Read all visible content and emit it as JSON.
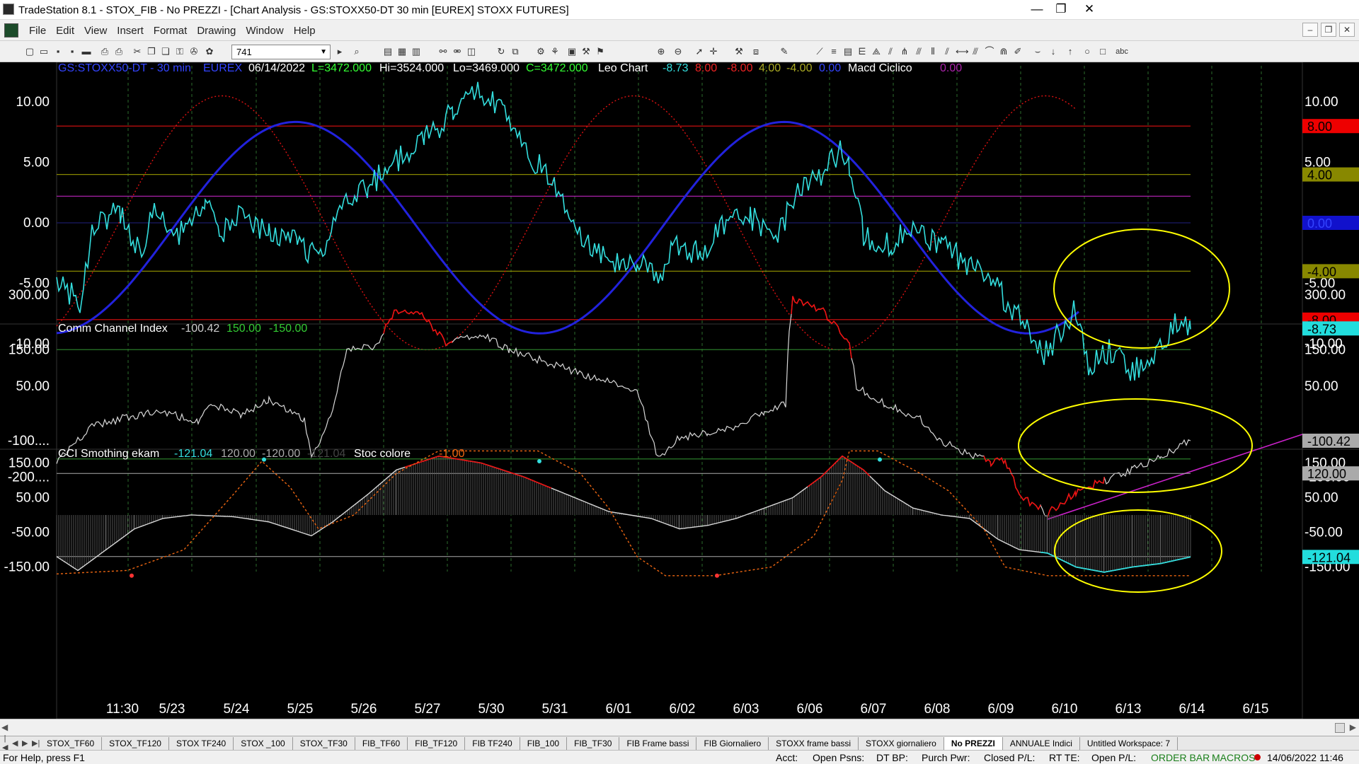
{
  "window": {
    "title": "TradeStation 8.1 - STOX_FIB - No PREZZI - [Chart Analysis - GS:STOXX50-DT  30 min  [EUREX] STOXX FUTURES]",
    "minimize_label": "—",
    "maximize_label": "❐",
    "close_label": "✕"
  },
  "menu": {
    "items": [
      "File",
      "Edit",
      "View",
      "Insert",
      "Format",
      "Drawing",
      "Window",
      "Help"
    ],
    "mdi_minimize": "–",
    "mdi_restore": "❐",
    "mdi_close": "✕"
  },
  "toolbar": {
    "combo_value": "741"
  },
  "chart": {
    "price_header": {
      "symbol": "GS:STOXX50-DT - 30 min",
      "exchange": "EUREX",
      "date": "06/14/2022",
      "last": "L=3472.000",
      "high": "Hi=3524.000",
      "low": "Lo=3469.000",
      "close": "C=3472.000",
      "study": "Leo Chart",
      "v1": "-8.73",
      "v2": "8.00",
      "v3": "-8.00",
      "v4": "4.00",
      "v5": "-4.00",
      "v6": "0.00",
      "study2": "Macd Ciclico",
      "v7": "0.00"
    },
    "cci_header": {
      "name": "Comm Channel Index",
      "v1": "-100.42",
      "v2": "150.00",
      "v3": "-150.00"
    },
    "ccis_header": {
      "name": "CCI Smothing ekam",
      "v1": "-121.04",
      "v2": "120.00",
      "v3": "-120.00",
      "v4": "-121.04",
      "name2": "Stoc colore",
      "v5": "-1.00"
    },
    "colors": {
      "background": "#000000",
      "cyan": "#33dddd",
      "blue": "#2222dd",
      "red": "#dd1111",
      "olive": "#888800",
      "purple": "#aa22aa",
      "white_line": "#c8c8c8",
      "yellow": "#ffff00",
      "magenta": "#cc22cc",
      "green_level": "#2a7a2a"
    },
    "x_labels": [
      "11:30",
      "5/23",
      "5/24",
      "5/25",
      "5/26",
      "5/27",
      "5/30",
      "5/31",
      "6/01",
      "6/02",
      "6/03",
      "6/06",
      "6/07",
      "6/08",
      "6/09",
      "6/10",
      "6/13",
      "6/14",
      "6/15"
    ],
    "panel1": {
      "left_ticks": [
        "10.00",
        "5.00",
        "0.00",
        "-5.00",
        "-10.00"
      ],
      "right_ticks": [
        "10.00",
        "5.00",
        "-5.00",
        "-10.00"
      ],
      "badges": [
        "8.00",
        "4.00",
        "0.00",
        "-4.00",
        "-8.00",
        "-8.73"
      ]
    },
    "panel2": {
      "left_ticks": [
        "300.00",
        "150.00",
        "50.00",
        "-100....",
        "-200...."
      ],
      "right_ticks": [
        "300.00",
        "150.00",
        "50.00",
        "-200.00"
      ],
      "badges": [
        "-100.42"
      ]
    },
    "panel3": {
      "left_ticks": [
        "150.00",
        "50.00",
        "-50.00",
        "-150.00"
      ],
      "right_ticks": [
        "150.00",
        "50.00",
        "-50.00",
        "-150.00"
      ],
      "badges": [
        "120.00",
        "-121.04"
      ]
    }
  },
  "chart_data": {
    "type": "line",
    "panels": [
      {
        "name": "Leo Chart / Macd Ciclico",
        "ylim": [
          -12.5,
          11.5
        ],
        "levels": [
          8,
          4,
          2.2,
          0,
          -4,
          -8
        ],
        "last_value": -8.73
      },
      {
        "name": "Comm Channel Index",
        "levels": [
          150,
          -150
        ],
        "last_value": -100.42
      },
      {
        "name": "CCI Smothing ekam",
        "levels": [
          120,
          -120
        ],
        "last_value": -121.04
      }
    ],
    "categories": [
      "11:30",
      "5/23",
      "5/24",
      "5/25",
      "5/26",
      "5/27",
      "5/30",
      "5/31",
      "6/01",
      "6/02",
      "6/03",
      "6/06",
      "6/07",
      "6/08",
      "6/09",
      "6/10",
      "6/13",
      "6/14",
      "6/15"
    ]
  },
  "tabs": {
    "items": [
      "STOX_TF60",
      "STOX_TF120",
      "STOX TF240",
      "STOX _100",
      "STOX_TF30",
      "FIB_TF60",
      "FIB_TF120",
      "FIB TF240",
      "FIB_100",
      "FIB_TF30",
      "FIB Frame bassi",
      "FIB Giornaliero",
      "STOXX frame bassi",
      "STOXX giornaliero",
      "No PREZZI",
      "ANNUALE Indici",
      "Untitled Workspace: 7"
    ],
    "active": "No PREZZI",
    "nav": [
      "|◀",
      "◀",
      "▶",
      "▶|"
    ]
  },
  "status": {
    "help": "For Help, press F1",
    "acct": "Acct:",
    "open_psns": "Open Psns:",
    "dt_bp": "DT BP:",
    "purch_pwr": "Purch Pwr:",
    "closed_pl": "Closed P/L:",
    "rt_te": "RT TE:",
    "open_pl": "Open P/L:",
    "order_bar": "ORDER BAR",
    "macros": "MACROS",
    "datetime": "14/06/2022 11:46"
  }
}
